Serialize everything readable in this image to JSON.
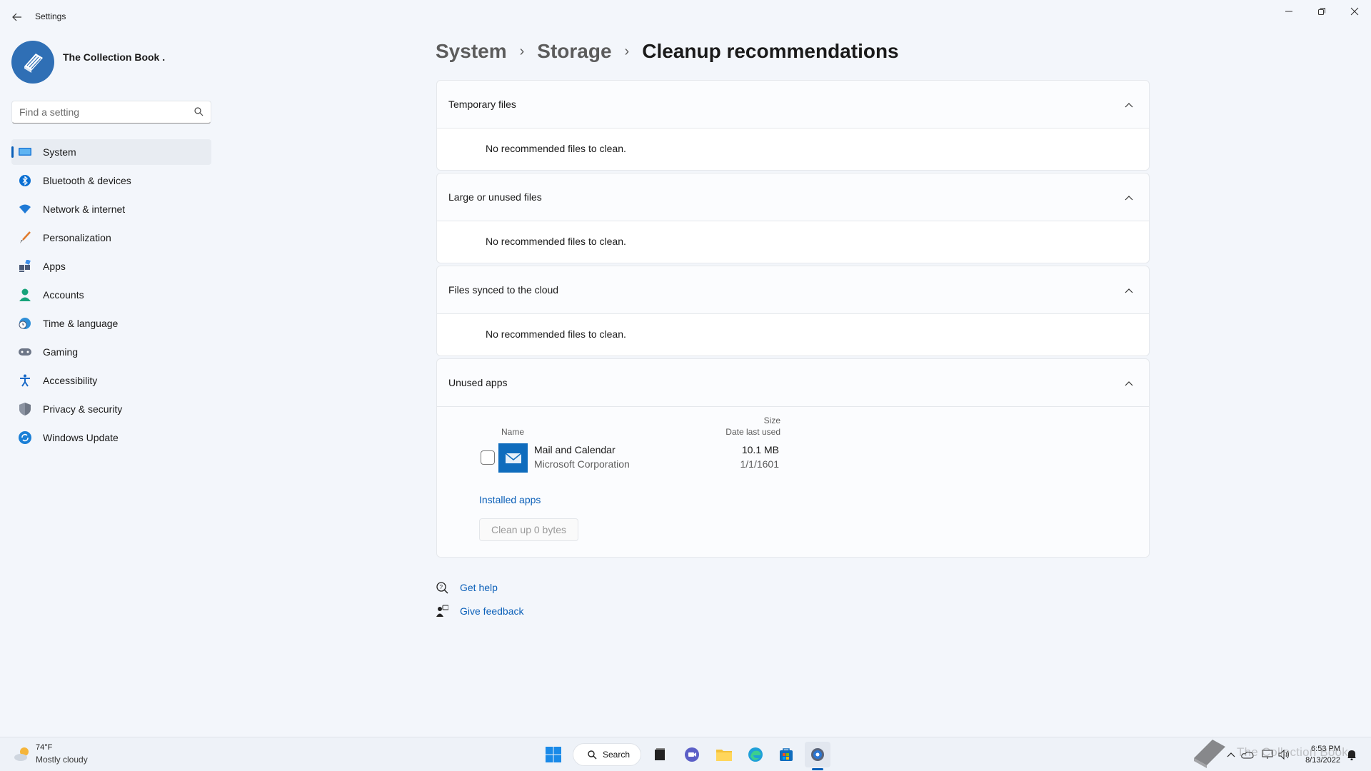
{
  "window": {
    "title": "Settings",
    "minimize_icon": "minimize-icon",
    "maximize_icon": "restore-icon",
    "close_icon": "close-icon"
  },
  "profile": {
    "name": "The Collection Book ."
  },
  "search": {
    "placeholder": "Find a setting"
  },
  "sidebar": {
    "items": [
      {
        "label": "System",
        "icon": "system-icon",
        "active": true
      },
      {
        "label": "Bluetooth & devices",
        "icon": "bluetooth-icon"
      },
      {
        "label": "Network & internet",
        "icon": "wifi-icon"
      },
      {
        "label": "Personalization",
        "icon": "brush-icon"
      },
      {
        "label": "Apps",
        "icon": "apps-icon"
      },
      {
        "label": "Accounts",
        "icon": "person-icon"
      },
      {
        "label": "Time & language",
        "icon": "clock-globe-icon"
      },
      {
        "label": "Gaming",
        "icon": "gamepad-icon"
      },
      {
        "label": "Accessibility",
        "icon": "accessibility-icon"
      },
      {
        "label": "Privacy & security",
        "icon": "shield-icon"
      },
      {
        "label": "Windows Update",
        "icon": "update-icon"
      }
    ]
  },
  "breadcrumb": {
    "items": [
      "System",
      "Storage",
      "Cleanup recommendations"
    ]
  },
  "sections": {
    "temporary": {
      "title": "Temporary files",
      "message": "No recommended files to clean."
    },
    "large": {
      "title": "Large or unused files",
      "message": "No recommended files to clean."
    },
    "cloud": {
      "title": "Files synced to the cloud",
      "message": "No recommended files to clean."
    },
    "unused_apps": {
      "title": "Unused apps",
      "columns": {
        "name": "Name",
        "size": "Size",
        "date": "Date last used"
      },
      "apps": [
        {
          "name": "Mail and Calendar",
          "publisher": "Microsoft Corporation",
          "size": "10.1 MB",
          "date": "1/1/1601",
          "checked": false
        }
      ],
      "installed_link": "Installed apps",
      "cleanup_button": "Clean up 0 bytes"
    }
  },
  "help": {
    "get_help": "Get help",
    "give_feedback": "Give feedback"
  },
  "taskbar": {
    "weather_temp": "74°F",
    "weather_desc": "Mostly cloudy",
    "search_label": "Search",
    "time": "6:53 PM",
    "date": "8/13/2022",
    "watermark_text": "The Collection Book"
  },
  "colors": {
    "accent": "#0a5fb8",
    "background": "#f3f6fb"
  }
}
